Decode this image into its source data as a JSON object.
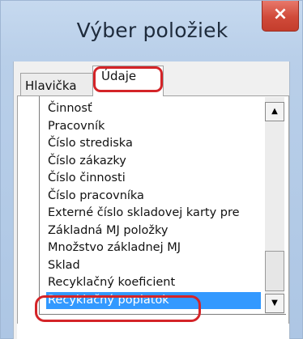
{
  "window": {
    "title": "Výber položiek",
    "close_symbol": "×"
  },
  "tabs": [
    {
      "label": "Hlavička",
      "active": false
    },
    {
      "label": "Údaje",
      "active": true
    }
  ],
  "list": {
    "items": [
      "Činnosť",
      "Pracovník",
      "Číslo strediska",
      "Číslo zákazky",
      "Číslo činnosti",
      "Číslo pracovníka",
      "Externé číslo skladovej karty pre",
      "Základná MJ položky",
      "Množstvo základnej MJ",
      "Sklad",
      "Recyklačný koeficient",
      "Recyklačný poplatok"
    ],
    "selected": "Recyklačný poplatok"
  },
  "scrollbar": {
    "up_icon": "▲",
    "down_icon": "▼"
  },
  "colors": {
    "annotation": "#d42428",
    "selection": "#3399ff",
    "close_button": "#d04a3a"
  }
}
